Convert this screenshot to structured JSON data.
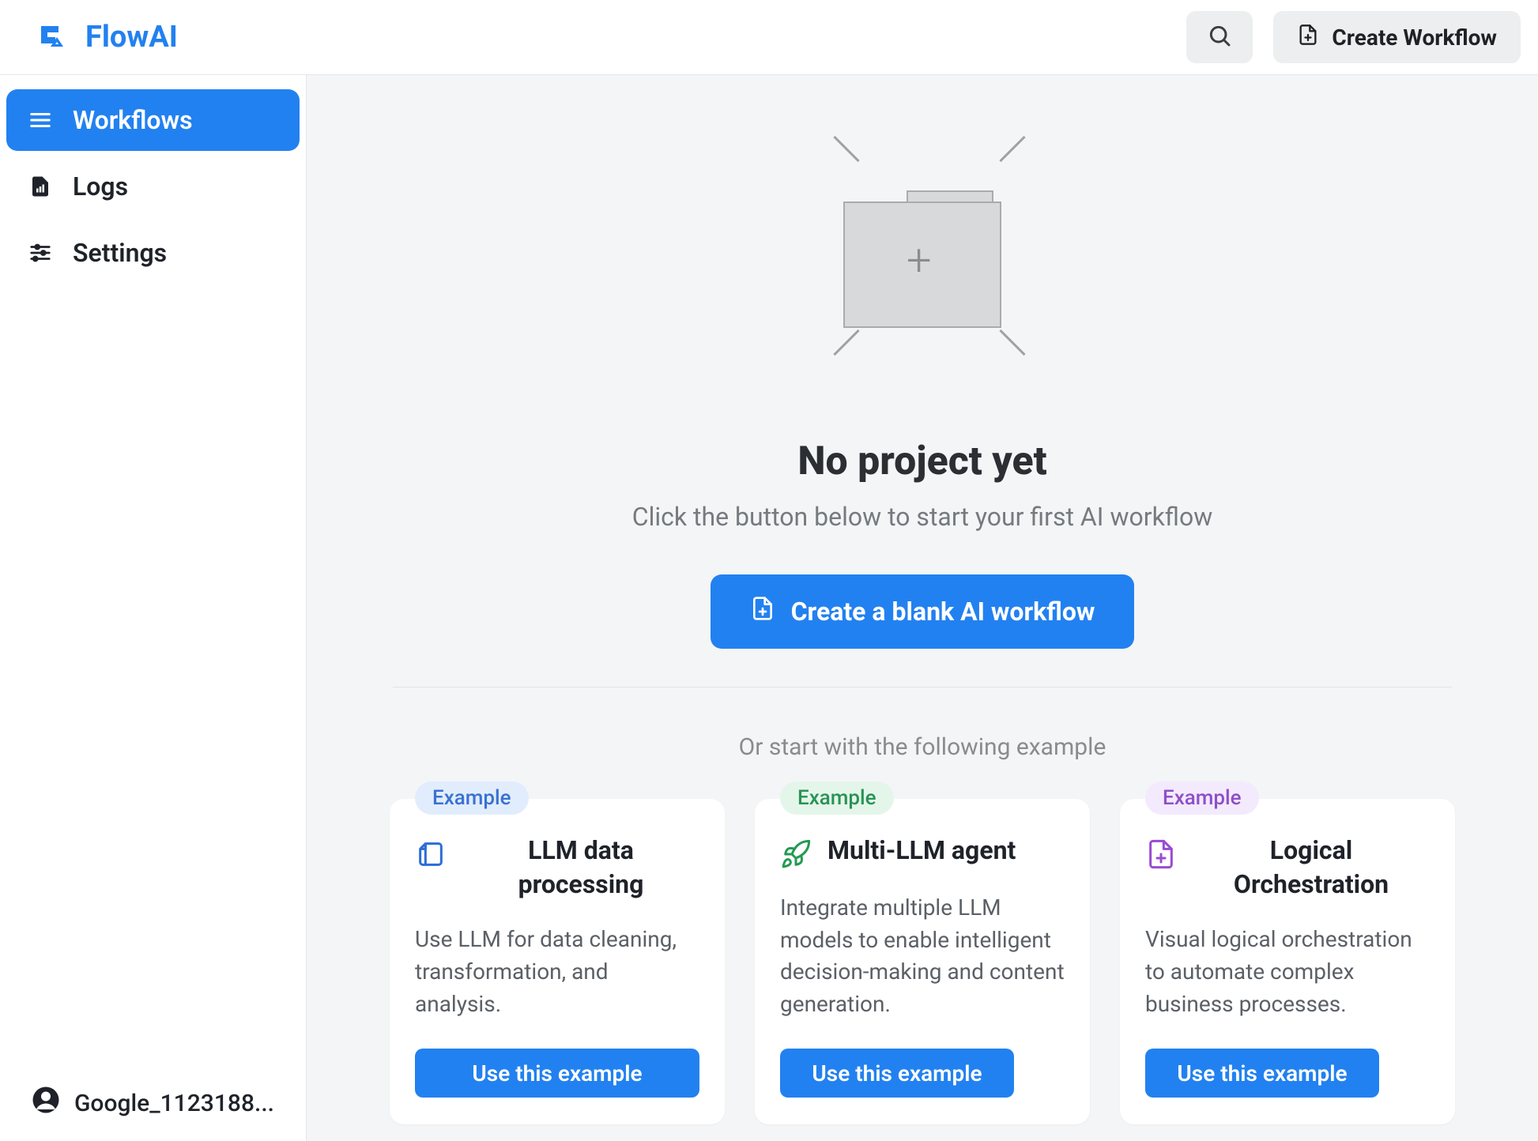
{
  "brand": {
    "name": "FlowAI"
  },
  "header": {
    "create_workflow_label": "Create Workflow"
  },
  "sidebar": {
    "items": [
      {
        "id": "workflows",
        "label": "Workflows",
        "icon": "menu-icon",
        "active": true
      },
      {
        "id": "logs",
        "label": "Logs",
        "icon": "file-chart-icon",
        "active": false
      },
      {
        "id": "settings",
        "label": "Settings",
        "icon": "sliders-icon",
        "active": false
      }
    ],
    "user": {
      "display_name": "Google_1123188..."
    }
  },
  "empty_state": {
    "title": "No project yet",
    "subtitle": "Click the button below to start your first AI workflow",
    "create_button_label": "Create a blank AI workflow",
    "examples_intro": "Or start with the following example"
  },
  "examples": {
    "badge_label": "Example",
    "use_button_label": "Use this example",
    "items": [
      {
        "id": "llm-data-processing",
        "title": "LLM data processing",
        "description": "Use LLM for data cleaning, transformation, and analysis.",
        "badge_color": "blue",
        "icon": "sheets-icon"
      },
      {
        "id": "multi-llm-agent",
        "title": "Multi-LLM agent",
        "description": "Integrate multiple LLM models to enable intelligent decision-making and content generation.",
        "badge_color": "green",
        "icon": "rocket-icon"
      },
      {
        "id": "logical-orchestration",
        "title": "Logical Orchestration",
        "description": "Visual logical orchestration to automate complex business processes.",
        "badge_color": "purple",
        "icon": "file-plus-icon"
      }
    ]
  },
  "colors": {
    "primary": "#2281f0"
  }
}
